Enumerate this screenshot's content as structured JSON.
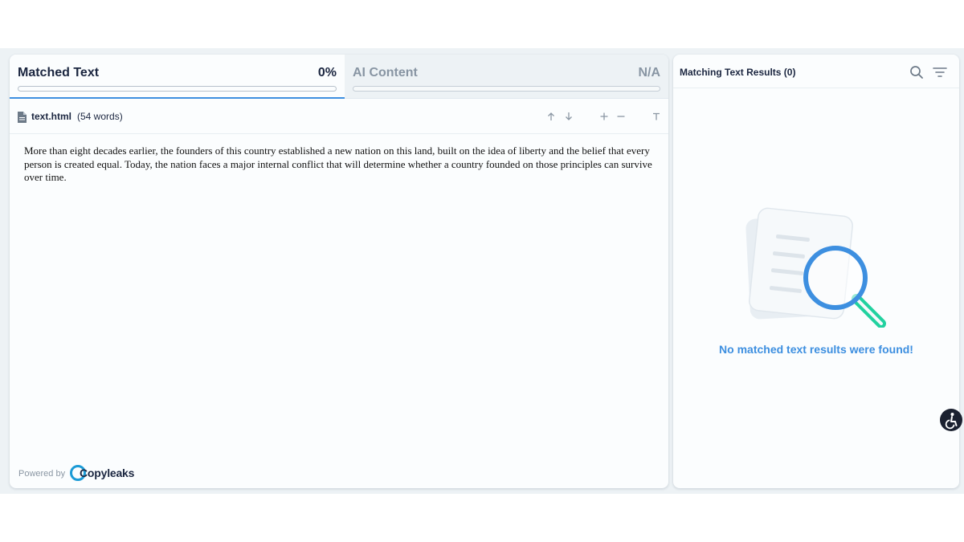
{
  "tabs": {
    "matched": {
      "title": "Matched Text",
      "value": "0%",
      "progress": 0
    },
    "ai": {
      "title": "AI Content",
      "value": "N/A"
    }
  },
  "file": {
    "name": "text.html",
    "words": "(54 words)",
    "icon": "document-icon",
    "tools": [
      "arrow-up-icon",
      "arrow-down-icon",
      "zoom-in-icon",
      "zoom-out-icon",
      "text-format-icon"
    ]
  },
  "content": {
    "text": "More than eight decades earlier, the founders of this country established a new nation on this land, built on the idea of liberty and the belief that every person is created equal. Today, the nation faces a major internal conflict that will determine whether a country founded on those principles can survive over time."
  },
  "footer": {
    "powered_by": "Powered by",
    "brand": "Copyleaks"
  },
  "results": {
    "title": "Matching Text Results (0)",
    "icons": [
      "search-icon",
      "filter-icon"
    ],
    "empty_message": "No matched text results were found!"
  },
  "colors": {
    "accent": "#3d8fe0",
    "magnifier_handle": "#21d19f",
    "text_dark": "#1b2640"
  },
  "accessibility": {
    "icon": "accessibility-icon"
  }
}
